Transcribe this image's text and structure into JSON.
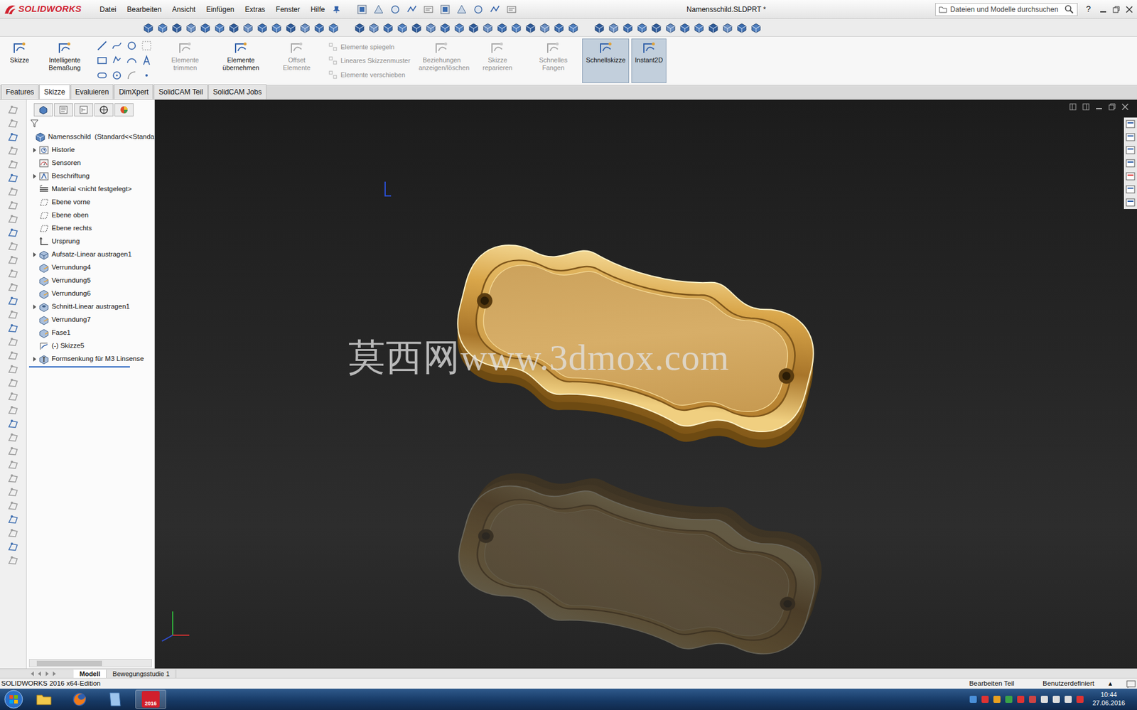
{
  "window": {
    "app": "SOLIDWORKS",
    "title": "Namensschild.SLDPRT *"
  },
  "menu": [
    "Datei",
    "Bearbeiten",
    "Ansicht",
    "Einfügen",
    "Extras",
    "Fenster",
    "Hilfe"
  ],
  "search": {
    "placeholder": "Dateien und Modelle durchsuchen"
  },
  "help": "?",
  "command_manager": [
    {
      "label": "Skizze",
      "kind": "large",
      "disabled": false,
      "selected": false
    },
    {
      "label": "Intelligente Bemaßung",
      "kind": "large",
      "disabled": false,
      "selected": false
    },
    {
      "label": "Elemente trimmen",
      "kind": "large",
      "disabled": true,
      "selected": false
    },
    {
      "label": "Elemente übernehmen",
      "kind": "large",
      "disabled": false,
      "selected": false
    },
    {
      "label": "Offset Elemente",
      "kind": "large",
      "disabled": true,
      "selected": false
    },
    {
      "label": "Elemente spiegeln",
      "kind": "small",
      "disabled": true,
      "selected": false
    },
    {
      "label": "Lineares Skizzenmuster",
      "kind": "small",
      "disabled": true,
      "selected": false
    },
    {
      "label": "Elemente verschieben",
      "kind": "small",
      "disabled": true,
      "selected": false
    },
    {
      "label": "Beziehungen anzeigen/löschen",
      "kind": "large",
      "disabled": true,
      "selected": false
    },
    {
      "label": "Skizze reparieren",
      "kind": "large",
      "disabled": true,
      "selected": false
    },
    {
      "label": "Schnelles Fangen",
      "kind": "large",
      "disabled": true,
      "selected": false
    },
    {
      "label": "Schnellskizze",
      "kind": "large",
      "disabled": false,
      "selected": true
    },
    {
      "label": "Instant2D",
      "kind": "large",
      "disabled": false,
      "selected": true
    }
  ],
  "cm_tabs": [
    {
      "label": "Features",
      "selected": false
    },
    {
      "label": "Skizze",
      "selected": true
    },
    {
      "label": "Evaluieren",
      "selected": false
    },
    {
      "label": "DimXpert",
      "selected": false
    },
    {
      "label": "SolidCAM Teil",
      "selected": false
    },
    {
      "label": "SolidCAM Jobs",
      "selected": false
    }
  ],
  "tree": {
    "root": "Namensschild  (Standard<<Standa",
    "items": [
      {
        "label": "Historie",
        "kind": "history",
        "expandable": true
      },
      {
        "label": "Sensoren",
        "kind": "sensor",
        "expandable": false
      },
      {
        "label": "Beschriftung",
        "kind": "annotation",
        "expandable": true
      },
      {
        "label": "Material <nicht festgelegt>",
        "kind": "material",
        "expandable": false
      },
      {
        "label": "Ebene vorne",
        "kind": "plane",
        "expandable": false
      },
      {
        "label": "Ebene oben",
        "kind": "plane",
        "expandable": false
      },
      {
        "label": "Ebene rechts",
        "kind": "plane",
        "expandable": false
      },
      {
        "label": "Ursprung",
        "kind": "origin",
        "expandable": false
      },
      {
        "label": "Aufsatz-Linear austragen1",
        "kind": "extrude",
        "expandable": true
      },
      {
        "label": "Verrundung4",
        "kind": "fillet",
        "expandable": false
      },
      {
        "label": "Verrundung5",
        "kind": "fillet",
        "expandable": false
      },
      {
        "label": "Verrundung6",
        "kind": "fillet",
        "expandable": false
      },
      {
        "label": "Schnitt-Linear austragen1",
        "kind": "cut",
        "expandable": true
      },
      {
        "label": "Verrundung7",
        "kind": "fillet",
        "expandable": false
      },
      {
        "label": "Fase1",
        "kind": "chamfer",
        "expandable": false
      },
      {
        "label": "(-) Skizze5",
        "kind": "sketch",
        "expandable": false
      },
      {
        "label": "Formsenkung für M3 Linsense",
        "kind": "hole",
        "expandable": true
      }
    ]
  },
  "viewport": {
    "watermark": "莫西网www.3dmox.com"
  },
  "bottom_tabs": [
    {
      "label": "Modell",
      "selected": true
    },
    {
      "label": "Bewegungsstudie 1",
      "selected": false
    }
  ],
  "status_bar": {
    "edition": "SOLIDWORKS 2016 x64-Edition",
    "mode": "Bearbeiten Teil",
    "units": "Benutzerdefiniert",
    "units_arrow": "▴"
  },
  "taskbar": {
    "sw_badge": "2016",
    "time": "10:44",
    "date": "27.06.2016"
  }
}
